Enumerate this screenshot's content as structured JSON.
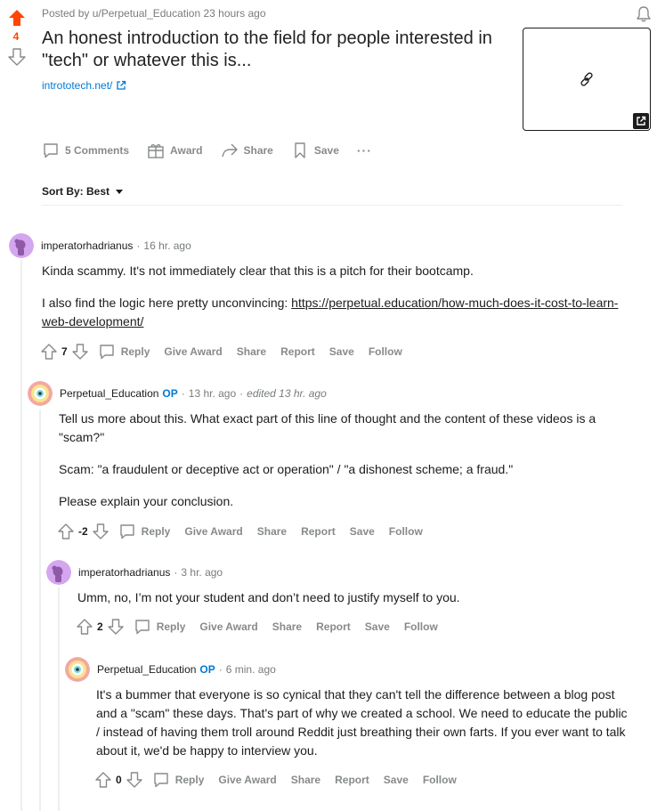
{
  "post": {
    "score": "4",
    "posted_by": "Posted by u/Perpetual_Education 23 hours ago",
    "title": "An honest introduction to the field for people interested in \"tech\" or whatever this is...",
    "link": "intrototech.net/",
    "actions": {
      "comments": "5 Comments",
      "award": "Award",
      "share": "Share",
      "save": "Save",
      "more": "···"
    },
    "sort": "Sort By: Best"
  },
  "comments": [
    {
      "author": "imperatorhadrianus",
      "op_badge": "",
      "time": "16 hr. ago",
      "edited": "",
      "body": [
        "Kinda scammy. It's not immediately clear that this is a pitch for their bootcamp.",
        "I also find the logic here pretty unconvincing: "
      ],
      "link": "https://perpetual.education/how-much-does-it-cost-to-learn-web-development/",
      "score": "7"
    },
    {
      "author": "Perpetual_Education",
      "op_badge": "OP",
      "time": "13 hr. ago",
      "edited": "edited 13 hr. ago",
      "body": [
        "Tell us more about this. What exact part of this line of thought and the content of these videos is a \"scam?\"",
        "Scam: \"a fraudulent or deceptive act or operation\" / \"a dishonest scheme; a fraud.\"",
        "Please explain your conclusion."
      ],
      "score": "-2"
    },
    {
      "author": "imperatorhadrianus",
      "op_badge": "",
      "time": "3 hr. ago",
      "edited": "",
      "body": [
        "Umm, no, I’m not your student and don’t need to justify myself to you."
      ],
      "score": "2"
    },
    {
      "author": "Perpetual_Education",
      "op_badge": "OP",
      "time": "6 min. ago",
      "edited": "",
      "body": [
        "It's a bummer that everyone is so cynical that they can't tell the difference between a blog post and a \"scam\" these days. That's part of why we created a school. We need to educate the public / instead of having them troll around Reddit just breathing their own farts. If you ever want to talk about it, we'd be happy to interview you."
      ],
      "score": "0"
    }
  ],
  "comment_actions": {
    "reply": "Reply",
    "give_award": "Give Award",
    "share": "Share",
    "report": "Report",
    "save": "Save",
    "follow": "Follow"
  },
  "colors": {
    "upvote": "#ff4500",
    "link": "#0079d3",
    "meta": "#787c7e",
    "action": "#878a8c"
  },
  "icons": [
    "upvote-arrow-icon",
    "downvote-arrow-icon",
    "bell-icon",
    "external-link-icon",
    "link-chain-icon",
    "comment-bubble-icon",
    "gift-award-icon",
    "share-arrow-icon",
    "bookmark-icon",
    "caret-down-icon"
  ]
}
